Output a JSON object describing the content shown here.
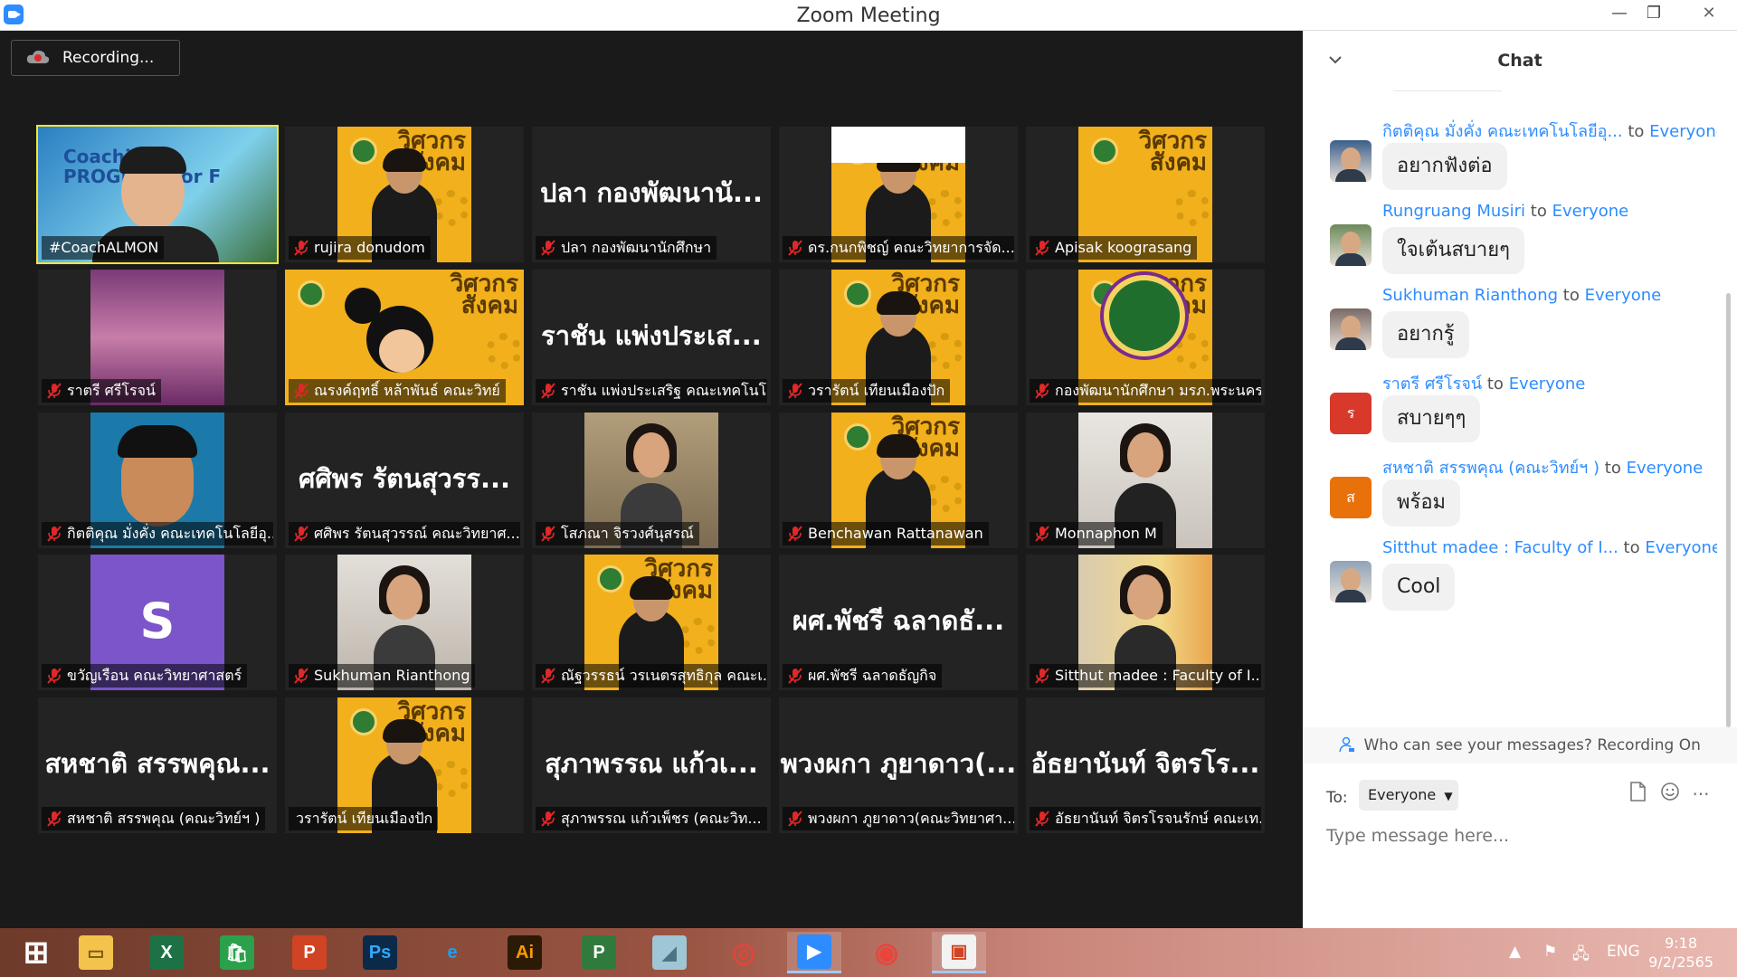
{
  "window": {
    "title": "Zoom Meeting",
    "minimize": "—",
    "maximize": "❐",
    "close": "✕"
  },
  "recording": {
    "label": "Recording..."
  },
  "participants": [
    {
      "name": "#CoachALMON",
      "tile_text": "Coaching PROGRAM for F",
      "muted": false
    },
    {
      "name": "rujira donudom",
      "muted": true
    },
    {
      "name": "ปลา กองพัฒนานักศึกษา",
      "big_name": "ปลา กองพัฒนานั...",
      "muted": true
    },
    {
      "name": "ดร.กนกพิชญ์ คณะวิทยาการจัด...",
      "muted": true
    },
    {
      "name": "Apisak koograsang",
      "muted": true
    },
    {
      "name": "ราตรี ศรีโรจน์",
      "muted": true
    },
    {
      "name": "ณรงค์ฤทธิ์ หล้าพันธ์ คณะวิทย์",
      "muted": true
    },
    {
      "name": "ราชัน แพ่งประเสริฐ คณะเทคโนโ...",
      "big_name": "ราชัน แพ่งประเส...",
      "muted": true
    },
    {
      "name": "วรารัตน์ เทียนเมืองปัก",
      "muted": true
    },
    {
      "name": "กองพัฒนานักศึกษา มรภ.พระนคร",
      "muted": true
    },
    {
      "name": "กิตติคุณ มั่งคั่ง คณะเทคโนโลยีอุ...",
      "muted": true
    },
    {
      "name": "ศศิพร รัตนสุวรรณ์ คณะวิทยาศ...",
      "big_name": "ศศิพร รัตนสุวรร...",
      "muted": true
    },
    {
      "name": "โสภณา จิรวงศ์นุสรณ์",
      "muted": true
    },
    {
      "name": "Benchawan Rattanawan",
      "muted": true
    },
    {
      "name": "Monnaphon M",
      "muted": true
    },
    {
      "name": "ขวัญเรือน คณะวิทยาศาสตร์",
      "avatar_letter": "S",
      "muted": true
    },
    {
      "name": "Sukhuman Rianthong",
      "muted": true
    },
    {
      "name": "ณัฐวรรธน์ วรเนตรสุทธิกุล คณะเ...",
      "muted": true
    },
    {
      "name": "ผศ.พัชรี ฉลาดธัญกิจ",
      "big_name": "ผศ.พัชรี ฉลาดธั...",
      "muted": true
    },
    {
      "name": "Sitthut madee : Faculty of I...",
      "muted": true
    },
    {
      "name": "สหชาติ สรรพคุณ (คณะวิทย์ฯ )",
      "big_name": "สหชาติ สรรพคุณ...",
      "muted": true
    },
    {
      "name": "วรารัตน์ เทียนเมืองปัก",
      "muted": false
    },
    {
      "name": "สุภาพรรณ แก้วเพ็ชร (คณะวิท...",
      "big_name": "สุภาพรรณ แก้วเ...",
      "muted": true
    },
    {
      "name": "พวงผกา ภูยาดาว(คณะวิทยาศา...",
      "big_name": "พวงผกา ภูยาดาว(...",
      "muted": true
    },
    {
      "name": "อัธยานันท์ จิตรโรจนรักษ์ คณะเท...",
      "big_name": "อัธยานันท์ จิตรโร...",
      "muted": true
    }
  ],
  "poster": {
    "title": "วิศวกร\nสังคม"
  },
  "chat": {
    "title": "Chat",
    "to_word": "to",
    "messages": [
      {
        "sender": "กิตติคุณ มั่งคั่ง คณะเทคโนโลยีอุ...",
        "recipient": "Everyone",
        "text": "อยากฟังต่อ"
      },
      {
        "sender": "Rungruang Musiri",
        "recipient": "Everyone",
        "text": "ใจเต้นสบายๆ"
      },
      {
        "sender": "Sukhuman Rianthong",
        "recipient": "Everyone",
        "text": "อยากรู้"
      },
      {
        "sender": "ราตรี ศรีโรจน์",
        "recipient": "Everyone",
        "text": "สบายๆๆ",
        "avatar_letter": "ร",
        "avatar_color": "#d8392b"
      },
      {
        "sender": "สหชาติ สรรพคุณ (คณะวิทย์ฯ )",
        "recipient": "Everyone",
        "text": "พร้อม",
        "avatar_letter": "ส",
        "avatar_color": "#e8710a"
      },
      {
        "sender": "Sitthut madee : Faculty of I...",
        "recipient": "Everyone",
        "text": "Cool"
      }
    ],
    "notice": "Who can see your messages? Recording On",
    "to_label": "To:",
    "to_value": "Everyone",
    "input_placeholder": "Type message here..."
  },
  "taskbar": {
    "apps": [
      "start",
      "file-explorer",
      "excel",
      "store",
      "powerpoint",
      "photoshop",
      "internet-explorer",
      "illustrator",
      "project",
      "sketch",
      "photoscape",
      "zoom",
      "chrome",
      "photos"
    ],
    "lang": "ENG",
    "time": "9:18",
    "date": "9/2/2565"
  },
  "colors": {
    "accent": "#2d8cff",
    "active_speaker": "#f5e43a",
    "poster_bg": "#f2b01c"
  }
}
